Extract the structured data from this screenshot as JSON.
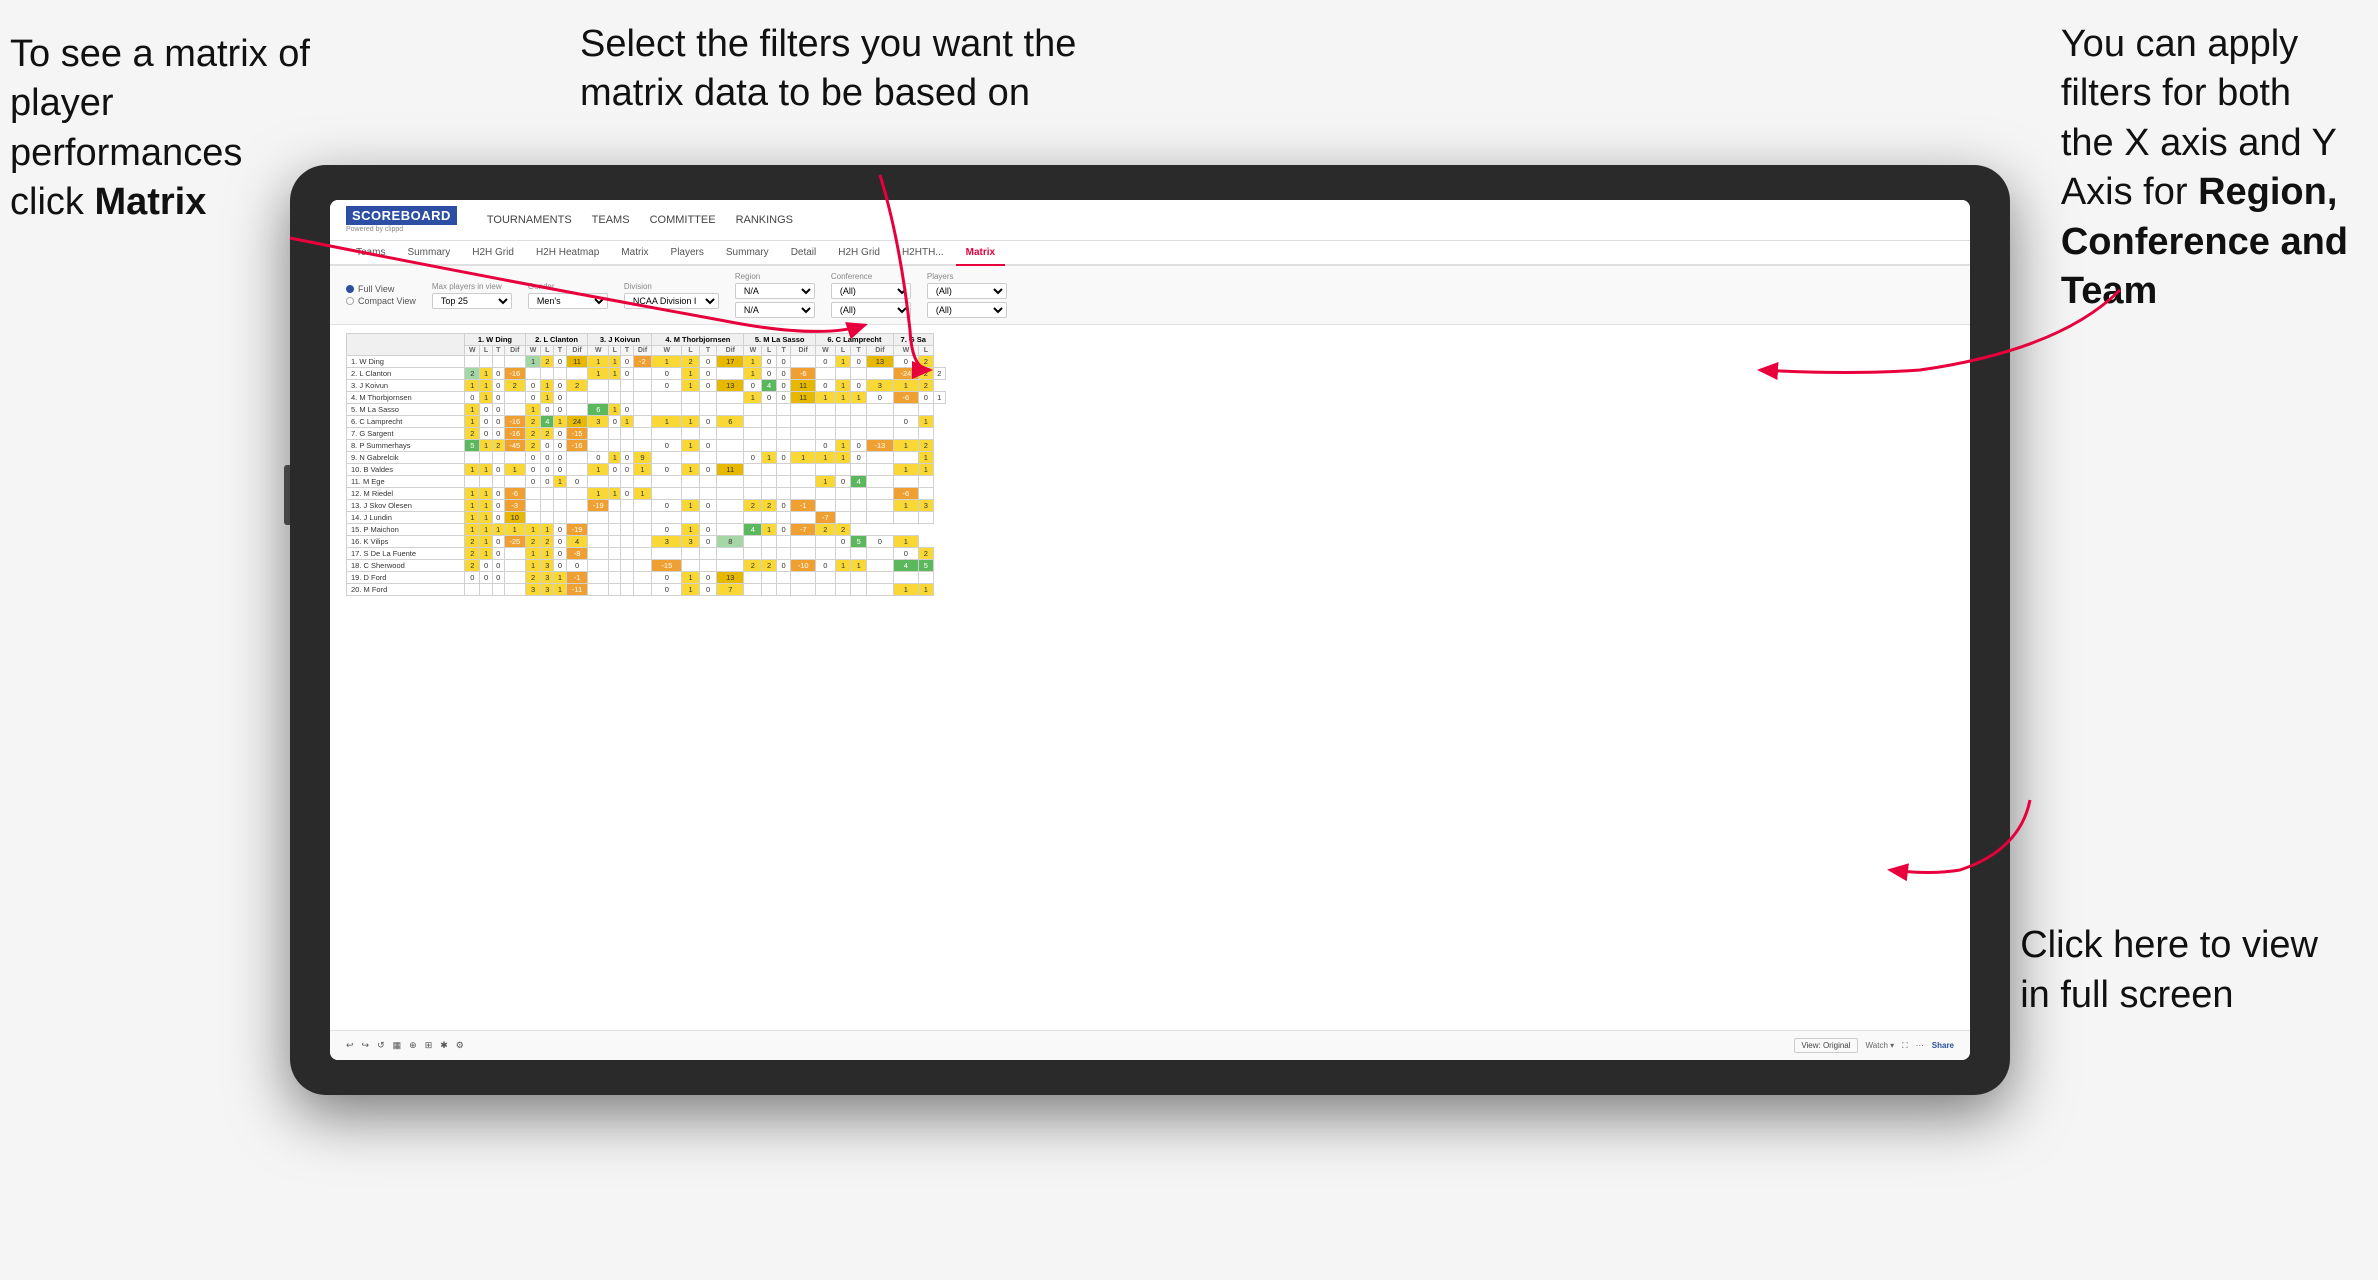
{
  "annotations": {
    "topleft": {
      "line1": "To see a matrix of",
      "line2": "player performances",
      "line3_plain": "click ",
      "line3_bold": "Matrix"
    },
    "topcenter": {
      "line1": "Select the filters you want the",
      "line2": "matrix data to be based on"
    },
    "topright": {
      "line1": "You  can apply",
      "line2": "filters for both",
      "line3": "the X axis and Y",
      "line4_plain": "Axis for ",
      "line4_bold": "Region,",
      "line5_bold": "Conference and",
      "line6_bold": "Team"
    },
    "bottomright": {
      "line1": "Click here to view",
      "line2": "in full screen"
    }
  },
  "app": {
    "logo_main": "SCOREBOARD",
    "logo_sub": "Powered by clippd",
    "nav": [
      "TOURNAMENTS",
      "TEAMS",
      "COMMITTEE",
      "RANKINGS"
    ],
    "tabs_row1": [
      "Teams",
      "Summary",
      "H2H Grid",
      "H2H Heatmap",
      "Matrix",
      "Players",
      "Summary",
      "Detail",
      "H2H Grid",
      "H2HTH...",
      "Matrix"
    ],
    "active_tab": "Matrix"
  },
  "filters": {
    "view_options": [
      "Full View",
      "Compact View"
    ],
    "selected_view": "Full View",
    "fields": [
      {
        "label": "Max players in view",
        "value": "Top 25"
      },
      {
        "label": "Gender",
        "value": "Men's"
      },
      {
        "label": "Division",
        "value": "NCAA Division I"
      },
      {
        "label": "Region",
        "value": "N/A"
      },
      {
        "label": "Conference",
        "value": "(All)"
      },
      {
        "label": "Players",
        "value": "(All)"
      }
    ]
  },
  "matrix": {
    "col_headers": [
      "1. W Ding",
      "2. L Clanton",
      "3. J Koivun",
      "4. M Thorbjornsen",
      "5. M La Sasso",
      "6. C Lamprecht",
      "7. G Sa"
    ],
    "sub_headers": [
      "W",
      "L",
      "T",
      "Dif"
    ],
    "rows": [
      {
        "name": "1. W Ding",
        "cells": [
          "",
          "",
          "",
          "",
          "1",
          "2",
          "0",
          "11",
          "1",
          "1",
          "0",
          "-2",
          "1",
          "2",
          "0",
          "17",
          "1",
          "0",
          "0",
          "",
          "0",
          "1",
          "0",
          "13",
          "0",
          "2"
        ]
      },
      {
        "name": "2. L Clanton",
        "cells": [
          "2",
          "1",
          "0",
          "-16",
          "",
          "",
          "",
          "",
          "1",
          "1",
          "0",
          "",
          "0",
          "1",
          "0",
          "",
          "1",
          "0",
          "0",
          "-6",
          "",
          "",
          "",
          "",
          "-24",
          "2",
          "2"
        ]
      },
      {
        "name": "3. J Koivun",
        "cells": [
          "1",
          "1",
          "0",
          "2",
          "0",
          "1",
          "0",
          "2",
          "",
          "",
          "",
          "",
          "0",
          "1",
          "0",
          "13",
          "0",
          "4",
          "0",
          "11",
          "0",
          "1",
          "0",
          "3",
          "1",
          "2"
        ]
      },
      {
        "name": "4. M Thorbjornsen",
        "cells": [
          "0",
          "1",
          "0",
          "",
          "0",
          "1",
          "0",
          "",
          "",
          "",
          "",
          "",
          "",
          "",
          "",
          "",
          "1",
          "0",
          "0",
          "11",
          "1",
          "1",
          "1",
          "0",
          "-6",
          "0",
          "1"
        ]
      },
      {
        "name": "5. M La Sasso",
        "cells": [
          "1",
          "0",
          "0",
          "",
          "1",
          "0",
          "0",
          "",
          "6",
          "1",
          "0",
          "",
          "",
          "",
          "",
          "",
          "",
          "",
          "",
          "",
          "",
          "",
          "",
          "",
          "",
          ""
        ]
      },
      {
        "name": "6. C Lamprecht",
        "cells": [
          "1",
          "0",
          "0",
          "-16",
          "2",
          "4",
          "1",
          "24",
          "3",
          "0",
          "1",
          "",
          "1",
          "1",
          "0",
          "6",
          "",
          "",
          "",
          "",
          "",
          "",
          "",
          "",
          "0",
          "1"
        ]
      },
      {
        "name": "7. G Sargent",
        "cells": [
          "2",
          "0",
          "0",
          "-16",
          "2",
          "2",
          "0",
          "-15",
          "",
          "",
          "",
          "",
          "",
          "",
          "",
          "",
          "",
          "",
          "",
          "",
          "",
          "",
          "",
          "",
          "",
          ""
        ]
      },
      {
        "name": "8. P Summerhays",
        "cells": [
          "5",
          "1",
          "2",
          "-45",
          "2",
          "0",
          "0",
          "-16",
          "",
          "",
          "",
          "",
          "0",
          "1",
          "0",
          "",
          "",
          "",
          "",
          "",
          "0",
          "1",
          "0",
          "-13",
          "1",
          "2"
        ]
      },
      {
        "name": "9. N Gabrelcik",
        "cells": [
          "",
          "",
          "",
          "",
          "0",
          "0",
          "0",
          "",
          "0",
          "1",
          "0",
          "9",
          "",
          "",
          "",
          "",
          "0",
          "1",
          "0",
          "1",
          "1",
          "1",
          "0",
          "",
          "",
          "1"
        ]
      },
      {
        "name": "10. B Valdes",
        "cells": [
          "1",
          "1",
          "0",
          "1",
          "0",
          "0",
          "0",
          "",
          "1",
          "0",
          "0",
          "1",
          "0",
          "1",
          "0",
          "11",
          "",
          "",
          "",
          "",
          "",
          "",
          "",
          "",
          "1",
          "1"
        ]
      },
      {
        "name": "11. M Ege",
        "cells": [
          "",
          "",
          "",
          "",
          "0",
          "0",
          "1",
          "0",
          "",
          "",
          "",
          "",
          "",
          "",
          "",
          "",
          "",
          "",
          "",
          "",
          "1",
          "0",
          "4",
          "",
          "",
          ""
        ]
      },
      {
        "name": "12. M Riedel",
        "cells": [
          "1",
          "1",
          "0",
          "-6",
          "",
          "",
          "",
          "",
          "1",
          "1",
          "0",
          "1",
          "",
          "",
          "",
          "",
          "",
          "",
          "",
          "",
          "",
          "",
          "",
          "",
          "-6",
          ""
        ]
      },
      {
        "name": "13. J Skov Olesen",
        "cells": [
          "1",
          "1",
          "0",
          "-3",
          "",
          "",
          "",
          "",
          "-19",
          "",
          "",
          "",
          "0",
          "1",
          "0",
          "",
          "2",
          "2",
          "0",
          "-1",
          "",
          "",
          "",
          "",
          "1",
          "3"
        ]
      },
      {
        "name": "14. J Lundin",
        "cells": [
          "1",
          "1",
          "0",
          "10",
          "",
          "",
          "",
          "",
          "",
          "",
          "",
          "",
          "",
          "",
          "",
          "",
          "",
          "",
          "",
          "",
          "-7",
          "",
          "",
          "",
          "",
          ""
        ]
      },
      {
        "name": "15. P Maichon",
        "cells": [
          "1",
          "1",
          "1",
          "1",
          "1",
          "1",
          "0",
          "-19",
          "",
          "",
          "",
          "",
          "0",
          "1",
          "0",
          "",
          "4",
          "1",
          "0",
          "-7",
          "2",
          "2"
        ]
      },
      {
        "name": "16. K Vilips",
        "cells": [
          "2",
          "1",
          "0",
          "-25",
          "2",
          "2",
          "0",
          "4",
          "",
          "",
          "",
          "",
          "3",
          "3",
          "0",
          "8",
          "",
          "",
          "",
          "",
          "",
          "0",
          "5",
          "0",
          "1"
        ]
      },
      {
        "name": "17. S De La Fuente",
        "cells": [
          "2",
          "1",
          "0",
          "",
          "1",
          "1",
          "0",
          "-8",
          "",
          "",
          "",
          "",
          "",
          "",
          "",
          "",
          "",
          "",
          "",
          "",
          "",
          "",
          "",
          "",
          "0",
          "2"
        ]
      },
      {
        "name": "18. C Sherwood",
        "cells": [
          "2",
          "0",
          "0",
          "",
          "1",
          "3",
          "0",
          "0",
          "",
          "",
          "",
          "",
          "-15",
          "",
          "",
          "",
          "2",
          "2",
          "0",
          "-10",
          "0",
          "1",
          "1",
          "",
          "4",
          "5"
        ]
      },
      {
        "name": "19. D Ford",
        "cells": [
          "0",
          "0",
          "0",
          "",
          "2",
          "3",
          "1",
          "-1",
          "",
          "",
          "",
          "",
          "0",
          "1",
          "0",
          "13",
          "",
          "",
          "",
          "",
          "",
          "",
          "",
          "",
          "",
          ""
        ]
      },
      {
        "name": "20. M Ford",
        "cells": [
          "",
          "",
          "",
          "",
          "3",
          "3",
          "1",
          "-11",
          "",
          "",
          "",
          "",
          "0",
          "1",
          "0",
          "7",
          "",
          "",
          "",
          "",
          "",
          "",
          "",
          "",
          "1",
          "1"
        ]
      }
    ]
  },
  "toolbar": {
    "left_items": [
      "←",
      "→",
      "↺",
      "⬛",
      "⊕",
      "⊞",
      "✱",
      "⚙"
    ],
    "view_label": "View: Original",
    "watch_label": "Watch ▾",
    "share_label": "Share"
  },
  "colors": {
    "accent_red": "#e8003d",
    "accent_blue": "#2c4fa3",
    "arrow_red": "#e8003d"
  }
}
